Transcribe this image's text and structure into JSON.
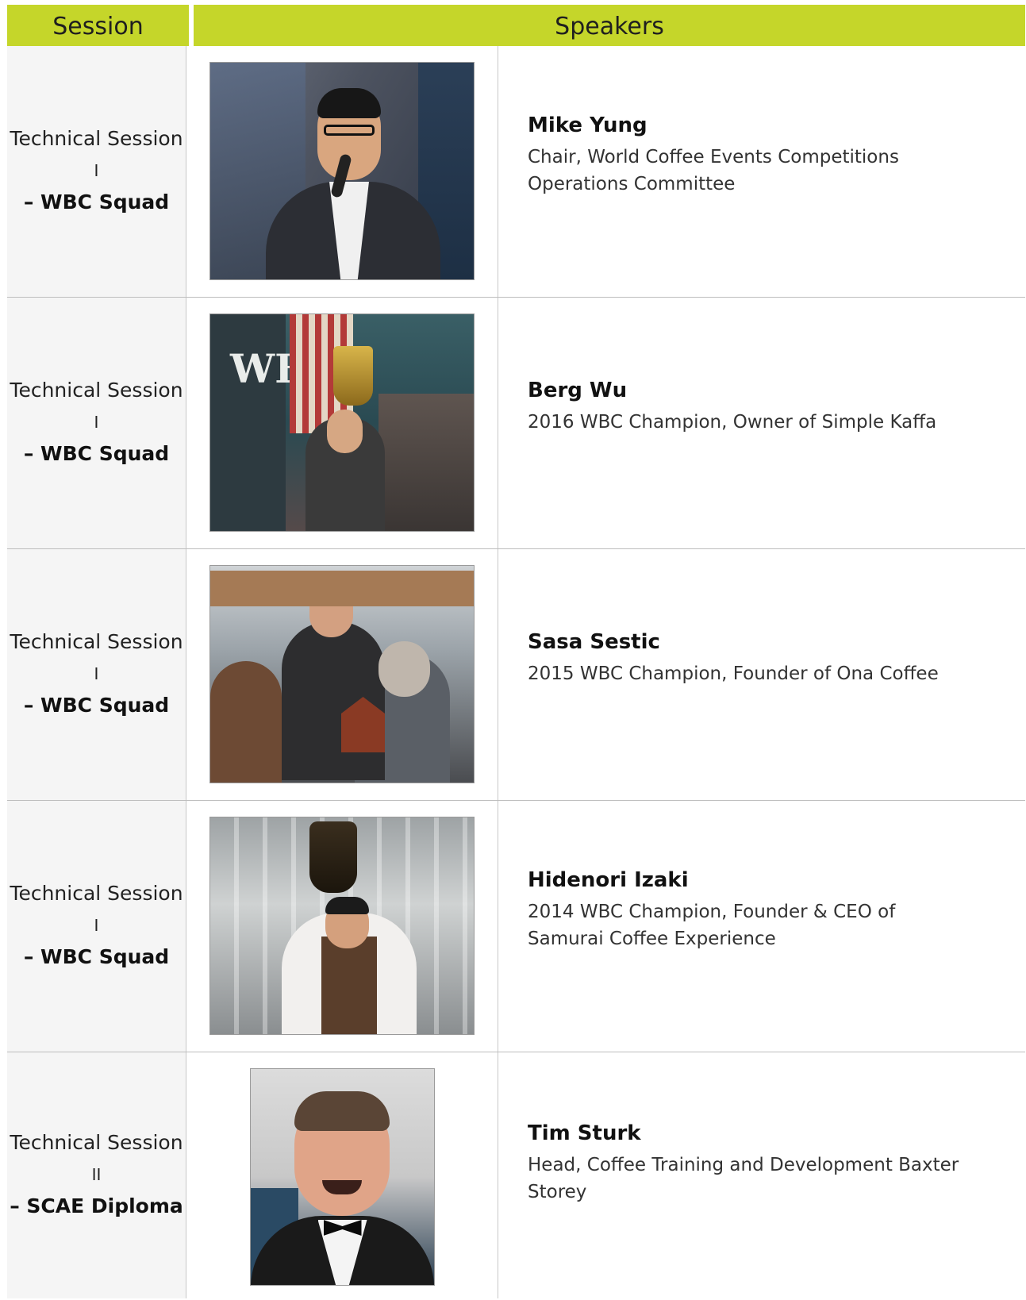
{
  "header": {
    "session_label": "Session",
    "speakers_label": "Speakers"
  },
  "rows": [
    {
      "session_title": "Technical Session",
      "session_mark": "I",
      "session_sub": "– WBC Squad",
      "speaker_name": "Mike Yung",
      "speaker_role": "Chair, World Coffee Events Competitions Operations Committee"
    },
    {
      "session_title": "Technical Session",
      "session_mark": "I",
      "session_sub": "– WBC Squad",
      "speaker_name": "Berg Wu",
      "speaker_role": "2016 WBC Champion, Owner of Simple Kaffa"
    },
    {
      "session_title": "Technical Session",
      "session_mark": "I",
      "session_sub": "– WBC Squad",
      "speaker_name": "Sasa Sestic",
      "speaker_role": "2015 WBC Champion, Founder of Ona Coffee"
    },
    {
      "session_title": "Technical Session",
      "session_mark": "I",
      "session_sub": "– WBC Squad",
      "speaker_name": "Hidenori Izaki",
      "speaker_role": "2014 WBC Champion, Founder & CEO of Samurai Coffee Experience"
    },
    {
      "session_title": "Technical Session",
      "session_mark": "II",
      "session_sub": "– SCAE Diploma",
      "speaker_name": "Tim Sturk",
      "speaker_role": "Head, Coffee Training and Development Baxter Storey"
    }
  ],
  "photo2_banner_text": "WBC",
  "colors": {
    "header_bg": "#c5d62a",
    "session_bg": "#f5f5f5"
  }
}
